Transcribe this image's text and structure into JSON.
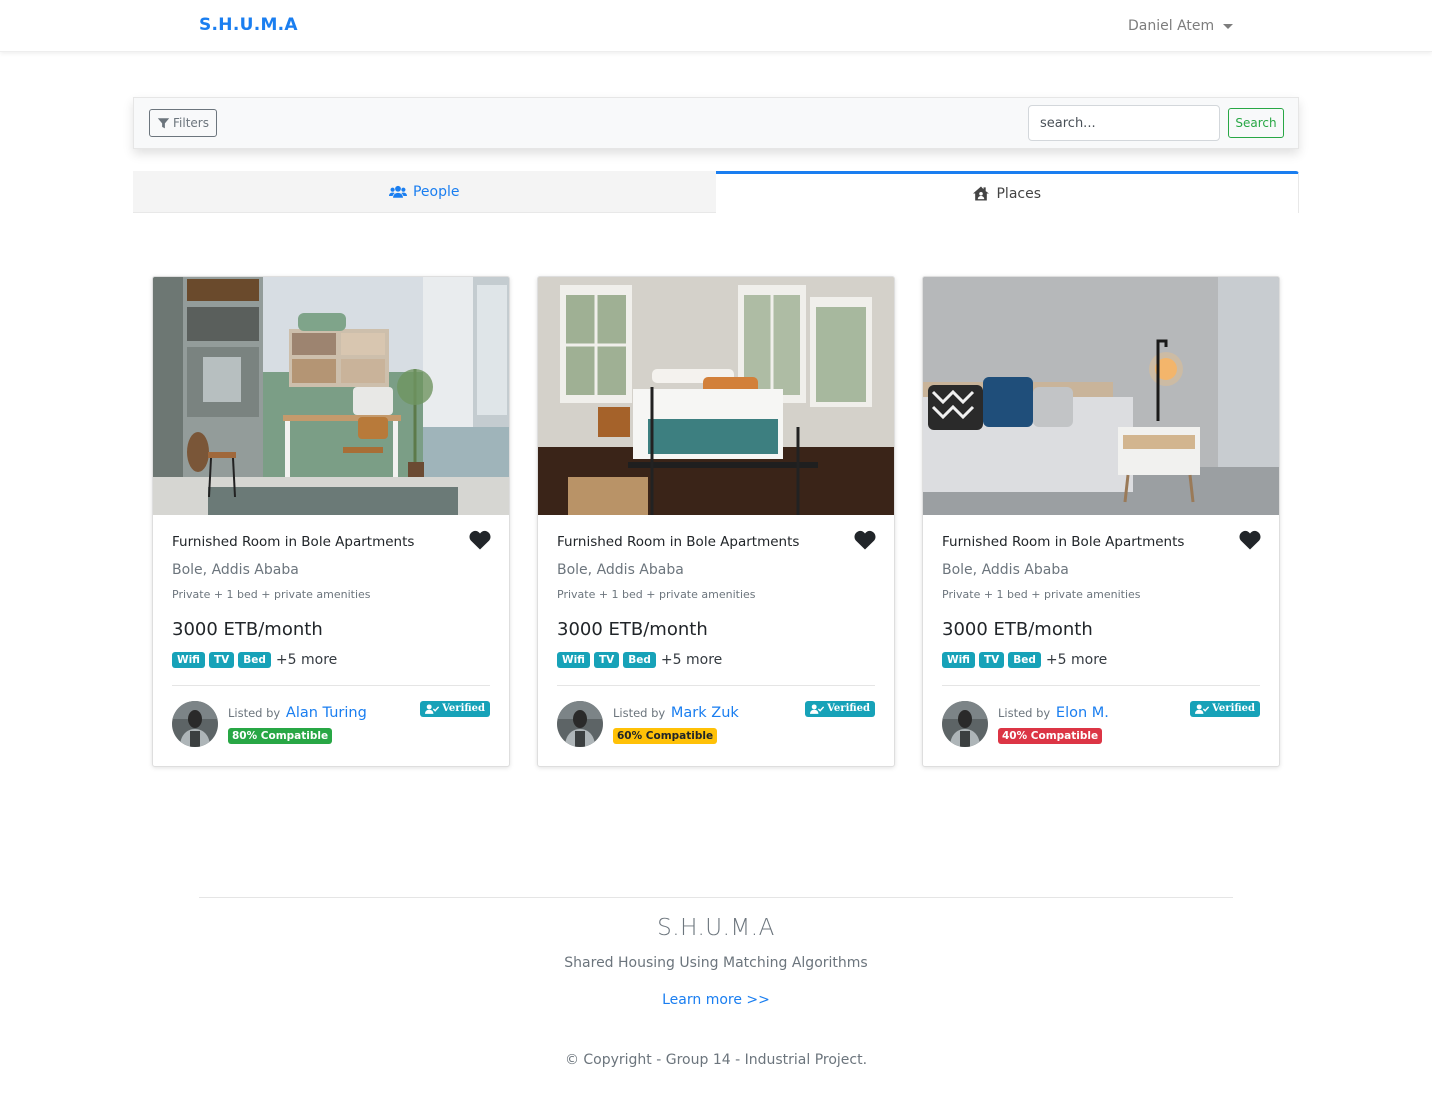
{
  "navbar": {
    "brand": "S.H.U.M.A",
    "user_name": "Daniel Atem"
  },
  "filter_bar": {
    "filters_label": "Filters",
    "search_placeholder": "search...",
    "search_value": "",
    "search_button_label": "Search"
  },
  "tabs": [
    {
      "label": "People",
      "icon": "users-icon",
      "active": false
    },
    {
      "label": "Places",
      "icon": "house-user-icon",
      "active": true
    }
  ],
  "listings": [
    {
      "title": "Furnished Room in Bole Apartments",
      "location": "Bole, Addis Ababa",
      "description": "Private + 1 bed + private amenities",
      "price": "3000 ETB/month",
      "amenities": [
        "Wifi",
        "TV",
        "Bed"
      ],
      "more_label": "+5 more",
      "listed_by_label": "Listed by",
      "lister_name": "Alan Turing",
      "compatibility_label": "80% Compatible",
      "compatibility_percent": 80,
      "compatibility_color": "#28a745",
      "compatibility_text_color": "#ffffff",
      "verified_label": "Verified",
      "image": "workspace-room-photo",
      "favorited": true
    },
    {
      "title": "Furnished Room in Bole Apartments",
      "location": "Bole, Addis Ababa",
      "description": "Private + 1 bed + private amenities",
      "price": "3000 ETB/month",
      "amenities": [
        "Wifi",
        "TV",
        "Bed"
      ],
      "more_label": "+5 more",
      "listed_by_label": "Listed by",
      "lister_name": "Mark Zuk",
      "compatibility_label": "60% Compatible",
      "compatibility_percent": 60,
      "compatibility_color": "#ffc107",
      "compatibility_text_color": "#212529",
      "verified_label": "Verified",
      "image": "bedroom-iron-bed-photo",
      "favorited": true
    },
    {
      "title": "Furnished Room in Bole Apartments",
      "location": "Bole, Addis Ababa",
      "description": "Private + 1 bed + private amenities",
      "price": "3000 ETB/month",
      "amenities": [
        "Wifi",
        "TV",
        "Bed"
      ],
      "more_label": "+5 more",
      "listed_by_label": "Listed by",
      "lister_name": "Elon M.",
      "compatibility_label": "40% Compatible",
      "compatibility_percent": 40,
      "compatibility_color": "#dc3545",
      "compatibility_text_color": "#ffffff",
      "verified_label": "Verified",
      "image": "bedroom-lamp-photo",
      "favorited": true
    }
  ],
  "footer": {
    "title": "S.H.U.M.A",
    "subtitle": "Shared Housing Using Matching Algorithms",
    "learn_more": "Learn more >>",
    "copyright": "© Copyright - Group 14 - Industrial Project."
  },
  "colors": {
    "primary": "#1a7ef0",
    "success": "#28a745",
    "info": "#17a2b8",
    "warning": "#ffc107",
    "danger": "#dc3545"
  }
}
